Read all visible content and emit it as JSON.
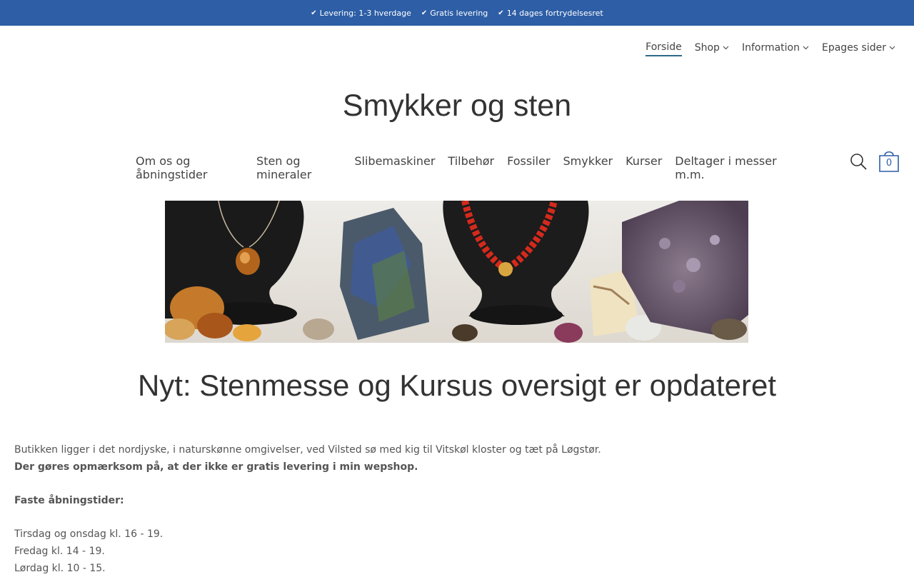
{
  "topbar": {
    "usps": [
      "Levering: 1-3 hverdage",
      "Gratis levering",
      "14 dages fortrydelsesret"
    ]
  },
  "topnav": {
    "items": [
      {
        "label": "Forside"
      },
      {
        "label": "Shop"
      },
      {
        "label": "Information"
      },
      {
        "label": "Epages sider"
      }
    ]
  },
  "site": {
    "title": "Smykker og sten"
  },
  "mainnav": {
    "items": [
      "Om os og åbningstider",
      "Sten og mineraler",
      "Slibemaskiner",
      "Tilbehør",
      "Fossiler",
      "Smykker",
      "Kurser",
      "Deltager i messer m.m."
    ]
  },
  "cart": {
    "count": "0"
  },
  "headline": "Nyt: Stenmesse og Kursus oversigt er opdateret",
  "content": {
    "intro": "Butikken ligger i det nordjyske, i naturskønne omgivelser, ved Vilsted sø med kig til Vitskøl kloster og tæt på Løgstør.",
    "notice": "Der gøres opmærksom på, at der ikke er gratis levering i min wepshop.",
    "hours_title": "Faste åbningstider:",
    "hours": [
      "Tirsdag og onsdag kl. 16 - 19.",
      "Fredag kl. 14 - 19.",
      "Lørdag kl. 10 - 15."
    ]
  },
  "colors": {
    "topbar": "#2d5ea6",
    "active_underline": "#2d6a87"
  }
}
